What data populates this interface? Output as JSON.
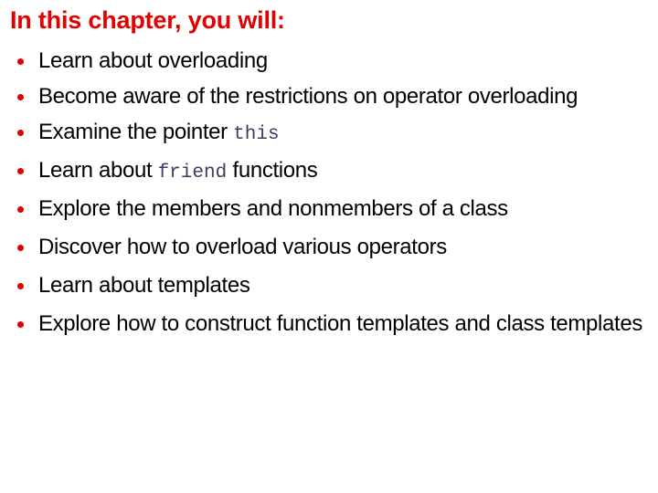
{
  "slide": {
    "title": "In this chapter, you will:",
    "title_color": "#e10000",
    "bullet_color": "#e10000",
    "text_color": "#000000",
    "code_color": "#3c3c64",
    "background_color": "#ffffff",
    "bullets": [
      {
        "id": "overloading",
        "group": "group-a",
        "segments": [
          {
            "text": "Learn about overloading",
            "style": "plain"
          }
        ]
      },
      {
        "id": "restrictions",
        "group": "group-a",
        "segments": [
          {
            "text": "Become aware of the restrictions on operator overloading",
            "style": "plain"
          }
        ]
      },
      {
        "id": "this-pointer",
        "group": "group-a",
        "segments": [
          {
            "text": "Examine the pointer ",
            "style": "plain"
          },
          {
            "text": "this",
            "style": "code"
          }
        ]
      },
      {
        "id": "friend-functions",
        "group": "group-a",
        "segments": [
          {
            "text": "Learn about ",
            "style": "plain"
          },
          {
            "text": "friend",
            "style": "code"
          },
          {
            "text": " functions",
            "style": "plain"
          }
        ]
      },
      {
        "id": "members-nonmembers",
        "group": "group-b",
        "segments": [
          {
            "text": "Explore the members and nonmembers of a class",
            "style": "plain"
          }
        ]
      },
      {
        "id": "overload-operators",
        "group": "group-b",
        "segments": [
          {
            "text": "Discover how to overload various operators",
            "style": "plain"
          }
        ]
      },
      {
        "id": "templates",
        "group": "group-b",
        "segments": [
          {
            "text": "Learn about templates",
            "style": "plain"
          }
        ]
      },
      {
        "id": "function-class-templates",
        "group": "group-b",
        "segments": [
          {
            "text": "Explore how to construct function templates and class templates",
            "style": "plain"
          }
        ]
      }
    ]
  }
}
